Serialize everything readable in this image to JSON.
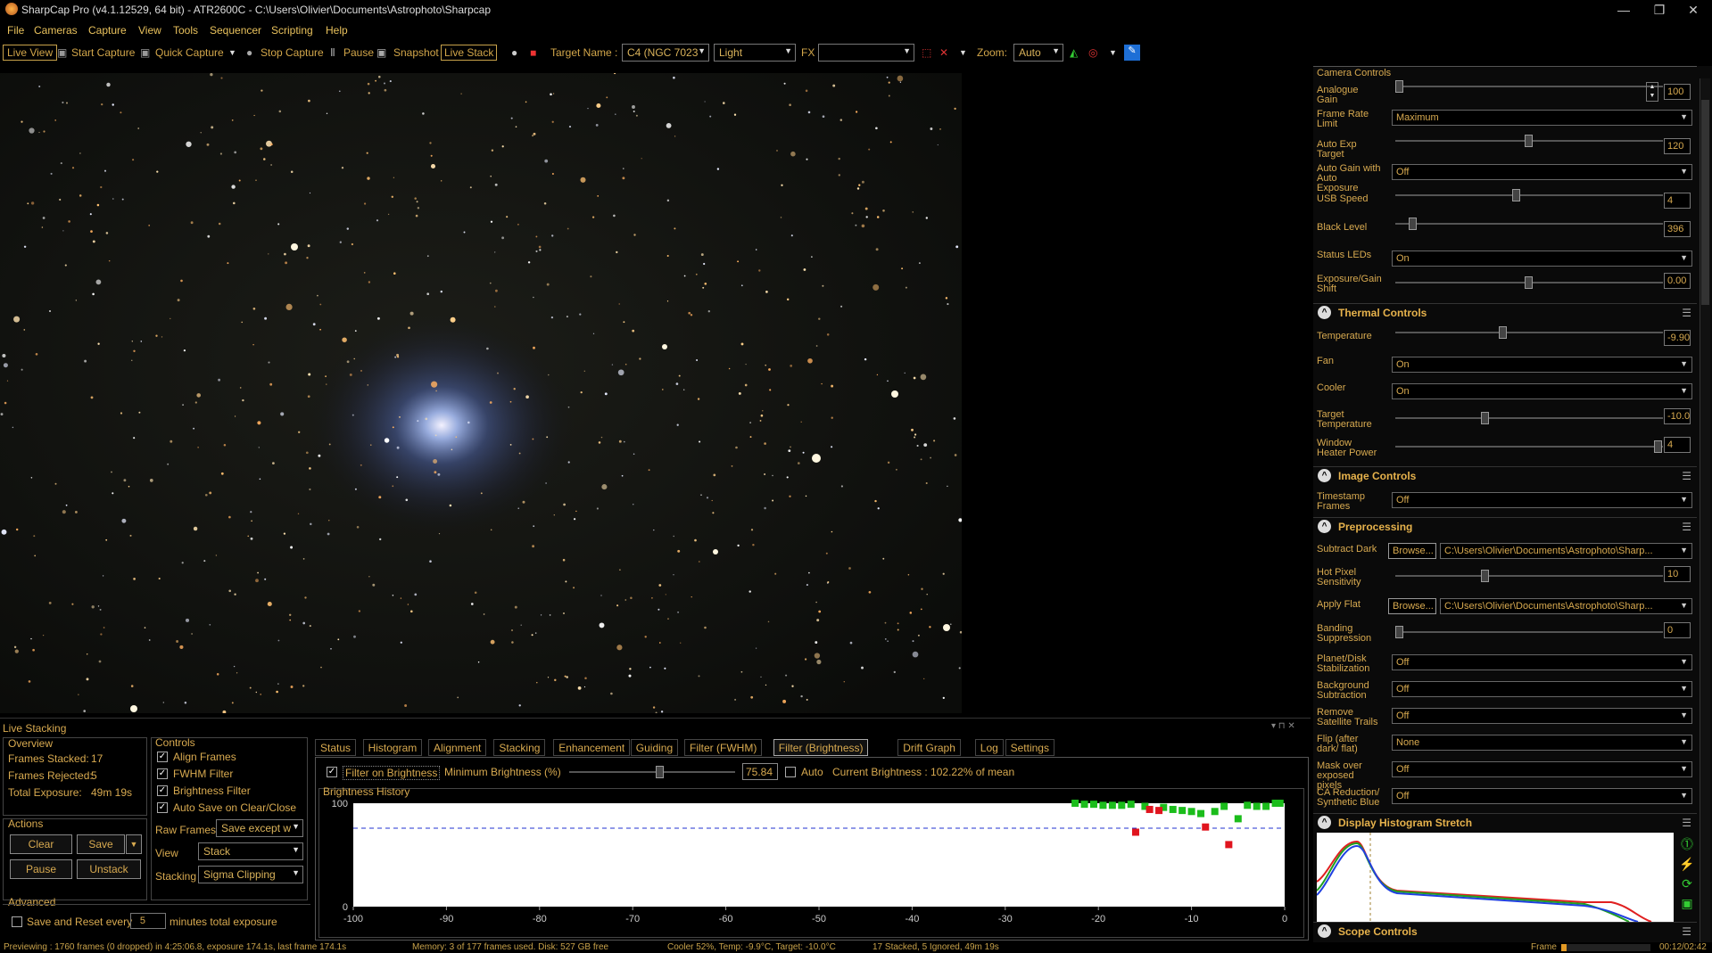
{
  "window": {
    "title": "SharpCap Pro (v4.1.12529, 64 bit) - ATR2600C - C:\\Users\\Olivier\\Documents\\Astrophoto\\Sharpcap",
    "minimize": "—",
    "restore": "❐",
    "close": "✕"
  },
  "menu": [
    "File",
    "Cameras",
    "Capture",
    "View",
    "Tools",
    "Sequencer",
    "Scripting",
    "Help"
  ],
  "toolbar": {
    "live_view": "Live View",
    "start_capture": "Start Capture",
    "quick_capture": "Quick Capture",
    "stop_capture": "Stop Capture",
    "pause": "Pause",
    "snapshot": "Snapshot",
    "live_stack": "Live Stack",
    "target_name_label": "Target Name :",
    "target_name": "C4 (NGC 7023",
    "frame_type": "Light",
    "fx_label": "FX",
    "fx_value": "",
    "zoom_label": "Zoom:",
    "zoom_value": "Auto"
  },
  "camera_controls": {
    "title": "Camera Controls",
    "analogue_gain": {
      "label": "Analogue Gain",
      "value": "100",
      "level": 0.0
    },
    "frame_rate_limit": {
      "label": "Frame Rate Limit",
      "value": "Maximum"
    },
    "auto_exp_target": {
      "label": "Auto Exp Target",
      "value": "120",
      "level": 0.5
    },
    "auto_gain": {
      "label": "Auto Gain with Auto Exposure",
      "value": "Off"
    },
    "usb_speed": {
      "label": "USB Speed",
      "value": "4",
      "level": 0.45
    },
    "black_level": {
      "label": "Black Level",
      "value": "396",
      "level": 0.05
    },
    "status_leds": {
      "label": "Status LEDs",
      "value": "On"
    },
    "exposure_gain_shift": {
      "label": "Exposure/Gain Shift",
      "value": "0.00",
      "level": 0.5
    }
  },
  "thermal": {
    "title": "Thermal Controls",
    "temperature": {
      "label": "Temperature",
      "value": "-9.90",
      "level": 0.4
    },
    "fan": {
      "label": "Fan",
      "value": "On"
    },
    "cooler": {
      "label": "Cooler",
      "value": "On"
    },
    "target_temp": {
      "label": "Target Temperature",
      "value": "-10.0",
      "level": 0.33
    },
    "window_heater": {
      "label": "Window Heater Power",
      "value": "4",
      "level": 1.0
    }
  },
  "image_controls": {
    "title": "Image Controls",
    "timestamp": {
      "label": "Timestamp Frames",
      "value": "Off"
    }
  },
  "preprocessing": {
    "title": "Preprocessing",
    "subtract_dark": {
      "label": "Subtract Dark",
      "browse": "Browse...",
      "path": "C:\\Users\\Olivier\\Documents\\Astrophoto\\Sharp..."
    },
    "hot_pixel": {
      "label": "Hot Pixel Sensitivity",
      "value": "10",
      "level": 0.33
    },
    "apply_flat": {
      "label": "Apply Flat",
      "browse": "Browse...",
      "path": "C:\\Users\\Olivier\\Documents\\Astrophoto\\Sharp..."
    },
    "banding": {
      "label": "Banding Suppression",
      "value": "0",
      "level": 0.0
    },
    "planet_disk": {
      "label": "Planet/Disk Stabilization",
      "value": "Off"
    },
    "background_sub": {
      "label": "Background Subtraction",
      "value": "Off"
    },
    "remove_sat": {
      "label": "Remove Satellite Trails",
      "value": "Off"
    },
    "flip": {
      "label": "Flip (after dark/ flat)",
      "value": "None"
    },
    "mask_over": {
      "label": "Mask over exposed pixels",
      "value": "Off"
    },
    "ca_reduction": {
      "label": "CA Reduction/ Synthetic Blue",
      "value": "Off"
    }
  },
  "display_histogram": {
    "title": "Display Histogram Stretch"
  },
  "scope_controls": {
    "title": "Scope Controls"
  },
  "live_stacking": {
    "title": "Live Stacking",
    "overview": {
      "title": "Overview",
      "frames_stacked_label": "Frames Stacked:",
      "frames_stacked": "17",
      "frames_rejected_label": "Frames Rejected:",
      "frames_rejected": "5",
      "total_exposure_label": "Total Exposure:",
      "total_exposure": "49m 19s"
    },
    "actions": {
      "title": "Actions",
      "clear": "Clear",
      "save": "Save",
      "pause": "Pause",
      "unstack": "Unstack"
    },
    "advanced": {
      "title": "Advanced",
      "save_reset": "Save and Reset every",
      "minutes": "5",
      "minutes_suffix": "minutes total exposure"
    },
    "controls": {
      "title": "Controls",
      "align": "Align Frames",
      "fwhm": "FWHM Filter",
      "brightness": "Brightness Filter",
      "autosave": "Auto Save on Clear/Close",
      "raw_frames_label": "Raw Frames",
      "raw_frames": "Save except w",
      "view_label": "View",
      "view": "Stack",
      "stacking_label": "Stacking",
      "stacking": "Sigma Clipping"
    },
    "tabs": [
      "Status",
      "Histogram",
      "Alignment",
      "Stacking",
      "Enhancement",
      "Guiding",
      "Filter (FWHM)",
      "Filter (Brightness)",
      "Drift Graph",
      "Log",
      "Settings"
    ],
    "active_tab": 7,
    "filter": {
      "filter_on": "Filter on Brightness",
      "min_label": "Minimum Brightness (%)",
      "min_value": "75.84",
      "auto": "Auto",
      "current": "Current Brightness : 102.22% of mean",
      "min_level": 0.55
    },
    "history_title": "Brightness History"
  },
  "chart_data": {
    "type": "scatter",
    "title": "Brightness History",
    "xlim": [
      -100,
      0
    ],
    "ylim": [
      0,
      100
    ],
    "xticks": [
      "-100",
      "-90",
      "-80",
      "-70",
      "-60",
      "-50",
      "-40",
      "-30",
      "-20",
      "-10",
      "0"
    ],
    "yticks": [
      "100",
      "0"
    ],
    "threshold": 75.84,
    "series": [
      {
        "name": "",
        "color": "#1bbd1b",
        "x": [
          -22.5,
          -21.5,
          -20.5,
          -19.5,
          -18.5,
          -17.5,
          -16.5,
          -15,
          -13,
          -12,
          -11,
          -10,
          -9,
          -7.5,
          -6.5,
          -5,
          -4,
          -3,
          -2,
          -1,
          -0.5
        ],
        "y": [
          100,
          99,
          99,
          98,
          98,
          98,
          99,
          97,
          96,
          94,
          93,
          92,
          90,
          92,
          97,
          85,
          98,
          97,
          97,
          100,
          100
        ]
      },
      {
        "name": "",
        "color": "#e0141e",
        "x": [
          -16,
          -14.5,
          -13.5,
          -8.5,
          -6
        ],
        "y": [
          72,
          94,
          93,
          77,
          60
        ]
      }
    ]
  },
  "statusbar": {
    "a": "Previewing : 1760 frames (0 dropped) in 4:25:06.8, exposure 174.1s, last frame 174.1s",
    "b": "Memory: 3 of 177 frames used. Disk: 527 GB free",
    "c": "Cooler 52%, Temp: -9.9°C, Target: -10.0°C",
    "d": "17 Stacked, 5 Ignored, 49m 19s",
    "e": "Frame",
    "f": "00:12/02:42"
  }
}
